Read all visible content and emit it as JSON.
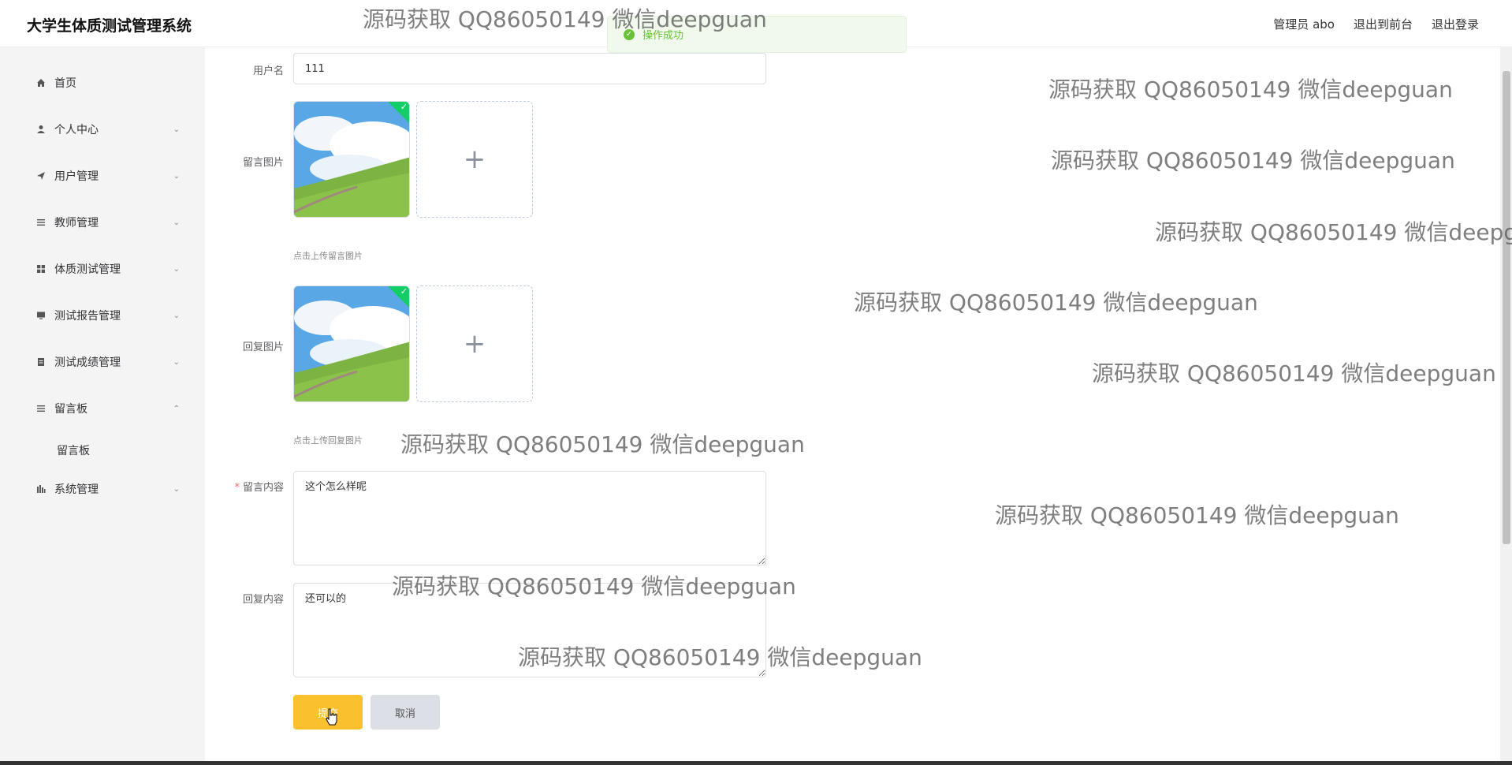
{
  "header": {
    "title": "大学生体质测试管理系统",
    "admin_label": "管理员 abo",
    "goto_front": "退出到前台",
    "logout": "退出登录"
  },
  "toast": {
    "message": "操作成功"
  },
  "sidebar": {
    "items": [
      {
        "label": "首页",
        "icon": "home-icon"
      },
      {
        "label": "个人中心",
        "icon": "user-icon"
      },
      {
        "label": "用户管理",
        "icon": "send-icon"
      },
      {
        "label": "教师管理",
        "icon": "list-icon"
      },
      {
        "label": "体质测试管理",
        "icon": "grid-icon"
      },
      {
        "label": "测试报告管理",
        "icon": "monitor-icon"
      },
      {
        "label": "测试成绩管理",
        "icon": "document-icon"
      },
      {
        "label": "留言板",
        "icon": "list-icon"
      },
      {
        "label": "系统管理",
        "icon": "chart-icon"
      }
    ],
    "submenu_label": "留言板"
  },
  "form": {
    "username_label": "用户名",
    "username_value": "111",
    "message_image_label": "留言图片",
    "message_image_hint": "点击上传留言图片",
    "reply_image_label": "回复图片",
    "reply_image_hint": "点击上传回复图片",
    "message_content_label": "留言内容",
    "message_content_value": "这个怎么样呢",
    "reply_content_label": "回复内容",
    "reply_content_value": "还可以的",
    "submit_label": "提交",
    "cancel_label": "取消",
    "upload_plus": "+"
  },
  "watermark": "源码获取 QQ86050149 微信deepguan"
}
